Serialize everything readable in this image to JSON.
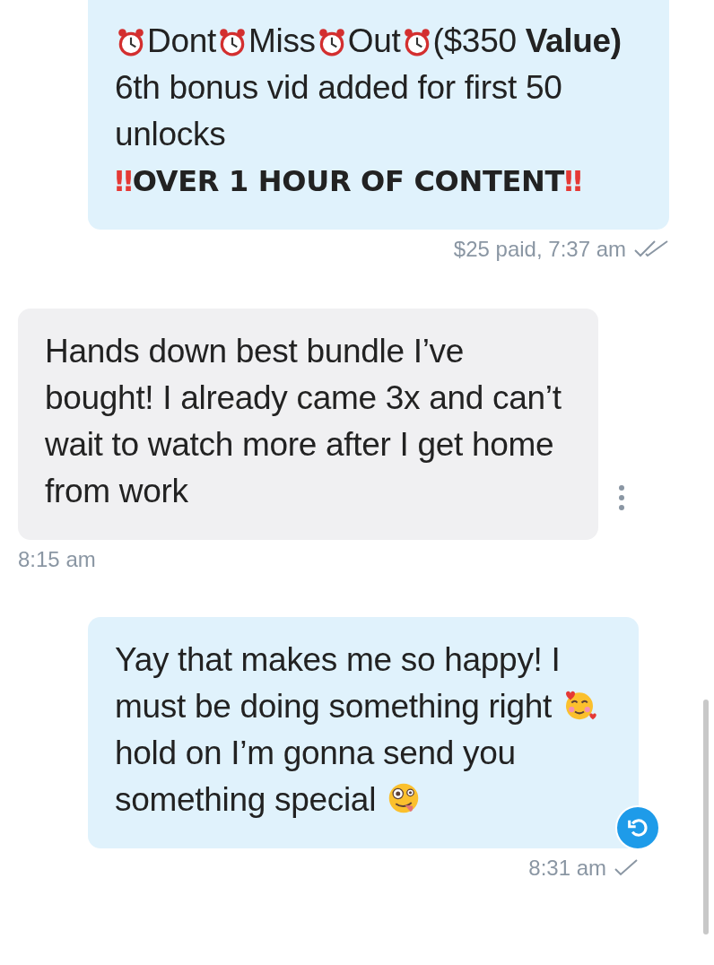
{
  "messages": [
    {
      "kind": "outgoing",
      "paragraphs": [
        {
          "kind": "clocked",
          "parts": [
            "Dont",
            "Miss",
            "Out",
            "($350 **Value)**"
          ]
        },
        {
          "kind": "plain",
          "text": "6th bonus vid added for first 50 unlocks"
        },
        {
          "kind": "alert",
          "lead": "‼",
          "text": "OVER 1 HOUR OF CONTENT",
          "trail": "‼"
        }
      ],
      "meta": "$25 paid, 7:37 am",
      "read": true
    },
    {
      "kind": "incoming",
      "paragraphs": [
        {
          "kind": "plain",
          "text": "Hands down best bundle I’ve bought! I already came 3x and can’t wait to watch more after I get home from work"
        }
      ],
      "meta": "8:15 am"
    },
    {
      "kind": "outgoing",
      "paragraphs": [
        {
          "kind": "inline",
          "parts": [
            {
              "kind": "text",
              "text": "Yay that makes me so happy! I must be doing something right "
            },
            {
              "kind": "hearts_face"
            },
            {
              "kind": "text",
              "text": " hold on I’m gonna send you something special "
            },
            {
              "kind": "zany_face"
            }
          ]
        }
      ],
      "meta": "8:31 am",
      "read": false
    }
  ]
}
